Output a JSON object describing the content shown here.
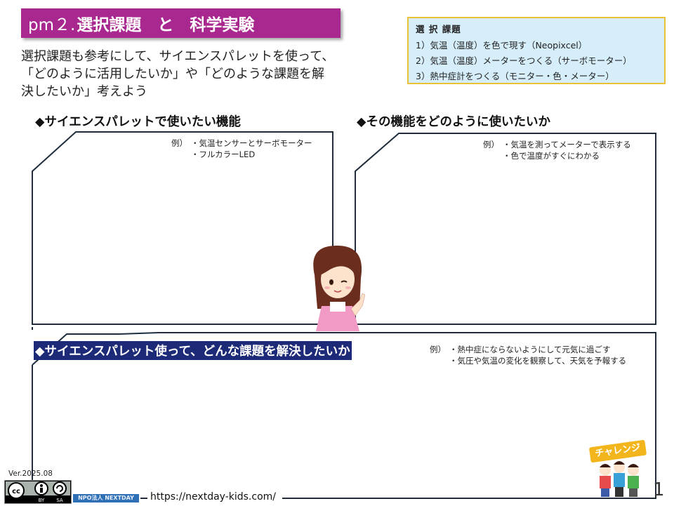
{
  "title": {
    "prefix": "pm２.",
    "main": "選択課題　と　科学実験"
  },
  "intro": {
    "line1": "選択課題も参考にして、サイエンスパレットを使って、",
    "line2": "「どのように活用したいか」や「どのような課題を解",
    "line3": "決したいか」考えよう"
  },
  "topics": {
    "heading": "選 択 課題",
    "items": [
      "1）気温（温度）を色で現す（Neopixcel）",
      "2）気温（温度）メーターをつくる（サーボモーター）",
      "3）熱中症計をつくる（モニター・色・メーター）"
    ]
  },
  "sections": {
    "functions": {
      "heading": "◆サイエンスパレットで使いたい機能",
      "example_label": "例）",
      "examples": [
        "・気温センサーとサーボモーター",
        "・フルカラーLED"
      ]
    },
    "usage": {
      "heading": "◆その機能をどのように使いたいか",
      "example_label": "例）",
      "examples": [
        "・気温を測ってメーターで表示する",
        "・色で温度がすぐにわかる"
      ]
    },
    "problem": {
      "heading": "◆サイエンスパレット使って、どんな課題を解決したいか",
      "example_label": "例）",
      "examples": [
        "・熱中症にならないようにして元気に過ごす",
        "・気圧や気温の変化を観察して、天気を予報する"
      ]
    }
  },
  "footer": {
    "version": "Ver.2025.08",
    "cc_labels": [
      "cc",
      "BY",
      "SA"
    ],
    "org": "NPO法人 NEXTDAY",
    "url": "https://nextday-kids.com/",
    "page": "1",
    "challenge": "チャレンジ"
  },
  "colors": {
    "banner": "#a8288f",
    "topic_bg": "#d6eef9",
    "topic_border": "#e8c233",
    "frame": "#1f2d3d",
    "section3_bg": "#1c2a78"
  }
}
